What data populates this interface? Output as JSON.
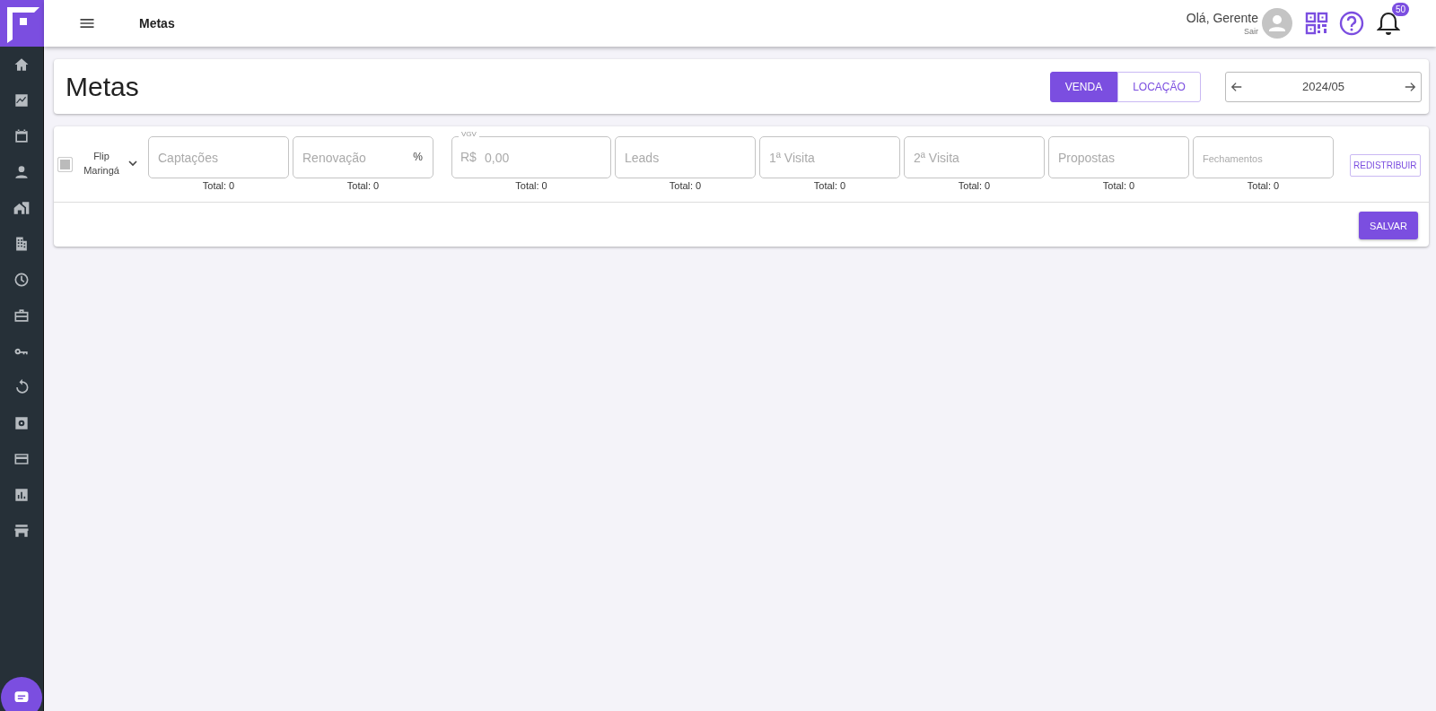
{
  "topbar": {
    "title": "Metas",
    "greeting": "Olá, Gerente",
    "logout": "Sair",
    "notifications": "50"
  },
  "header": {
    "title": "Metas",
    "tabs": [
      {
        "label": "VENDA",
        "selected": true
      },
      {
        "label": "LOCAÇÃO",
        "selected": false
      }
    ],
    "period": "2024/05"
  },
  "goals": {
    "row": {
      "checked": false,
      "name": "Flip Maringá",
      "expanded": false
    },
    "fields": [
      {
        "kind": "plain",
        "placeholder": "Captações",
        "total": "Total: 0"
      },
      {
        "kind": "percent",
        "placeholder": "Renovação",
        "suffix": "%",
        "total": "Total: 0"
      },
      {
        "kind": "currency",
        "label": "VGV",
        "prefix": "R$",
        "placeholder": "0,00",
        "total": "Total: 0"
      },
      {
        "kind": "plain",
        "placeholder": "Leads",
        "total": "Total: 0"
      },
      {
        "kind": "plain",
        "placeholder": "1ª Visita",
        "total": "Total: 0"
      },
      {
        "kind": "plain",
        "placeholder": "2ª Visita",
        "total": "Total: 0"
      },
      {
        "kind": "plain",
        "placeholder": "Propostas",
        "total": "Total: 0"
      },
      {
        "kind": "compact",
        "placeholder": "Fechamentos",
        "total": "Total: 0"
      }
    ],
    "redistribute": "REDISTRIBUIR",
    "save": "SALVAR"
  }
}
